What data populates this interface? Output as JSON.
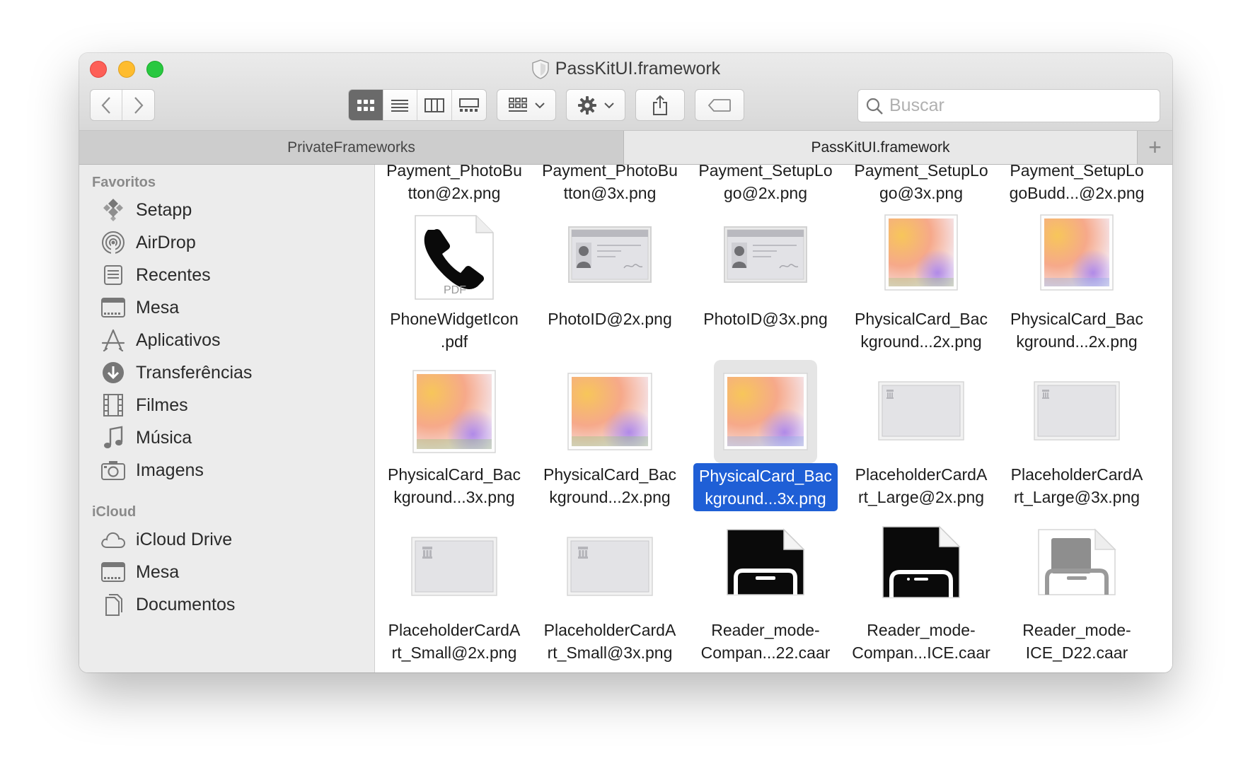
{
  "window": {
    "title": "PassKitUI.framework"
  },
  "toolbar": {
    "back": "‹",
    "forward": "›",
    "search_placeholder": "Buscar"
  },
  "tabs": [
    {
      "label": "PrivateFrameworks"
    },
    {
      "label": "PassKitUI.framework"
    },
    {
      "label": "+"
    }
  ],
  "sidebar": {
    "favorites_header": "Favoritos",
    "favorites": [
      {
        "label": "Setapp",
        "icon": "setapp-icon"
      },
      {
        "label": "AirDrop",
        "icon": "airdrop-icon"
      },
      {
        "label": "Recentes",
        "icon": "recents-icon"
      },
      {
        "label": "Mesa",
        "icon": "desktop-icon"
      },
      {
        "label": "Aplicativos",
        "icon": "applications-icon"
      },
      {
        "label": "Transferências",
        "icon": "downloads-icon"
      },
      {
        "label": "Filmes",
        "icon": "movies-icon"
      },
      {
        "label": "Música",
        "icon": "music-icon"
      },
      {
        "label": "Imagens",
        "icon": "pictures-icon"
      }
    ],
    "icloud_header": "iCloud",
    "icloud": [
      {
        "label": "iCloud Drive",
        "icon": "cloud-icon"
      },
      {
        "label": "Mesa",
        "icon": "desktop-icon"
      },
      {
        "label": "Documentos",
        "icon": "documents-icon"
      }
    ]
  },
  "files": {
    "row0": [
      {
        "l1": "Payment_PhotoBu",
        "l2": "tton@2x.png"
      },
      {
        "l1": "Payment_PhotoBu",
        "l2": "tton@3x.png"
      },
      {
        "l1": "Payment_SetupLo",
        "l2": "go@2x.png"
      },
      {
        "l1": "Payment_SetupLo",
        "l2": "go@3x.png"
      },
      {
        "l1": "Payment_SetupLo",
        "l2": "goBudd...@2x.png"
      }
    ],
    "row1": [
      {
        "l1": "PhoneWidgetIcon",
        "l2": ".pdf",
        "kind": "pdf-phone"
      },
      {
        "l1": "PhotoID@2x.png",
        "l2": "",
        "kind": "photoid"
      },
      {
        "l1": "PhotoID@3x.png",
        "l2": "",
        "kind": "photoid"
      },
      {
        "l1": "PhysicalCard_Bac",
        "l2": "kground...2x.png",
        "kind": "gradient"
      },
      {
        "l1": "PhysicalCard_Bac",
        "l2": "kground...2x.png",
        "kind": "gradient"
      }
    ],
    "row2": [
      {
        "l1": "PhysicalCard_Bac",
        "l2": "kground...3x.png",
        "kind": "gradient"
      },
      {
        "l1": "PhysicalCard_Bac",
        "l2": "kground...2x.png",
        "kind": "gradient"
      },
      {
        "l1": "PhysicalCard_Bac",
        "l2": "kground...3x.png",
        "kind": "gradient",
        "selected": true
      },
      {
        "l1": "PlaceholderCardA",
        "l2": "rt_Large@2x.png",
        "kind": "placeholder"
      },
      {
        "l1": "PlaceholderCardA",
        "l2": "rt_Large@3x.png",
        "kind": "placeholder"
      }
    ],
    "row3": [
      {
        "l1": "PlaceholderCardA",
        "l2": "rt_Small@2x.png",
        "kind": "placeholder"
      },
      {
        "l1": "PlaceholderCardA",
        "l2": "rt_Small@3x.png",
        "kind": "placeholder"
      },
      {
        "l1": "Reader_mode-",
        "l2": "Compan...22.caar",
        "kind": "reader-dark"
      },
      {
        "l1": "Reader_mode-",
        "l2": "Compan...ICE.caar",
        "kind": "reader-dark2"
      },
      {
        "l1": "Reader_mode-",
        "l2": "ICE_D22.caar",
        "kind": "reader-light"
      }
    ]
  },
  "colors": {
    "selection": "#1f5fd6",
    "sidebar_bg": "#ececec",
    "traffic_red": "#fd5f57",
    "traffic_yellow": "#febc2e",
    "traffic_green": "#28c840"
  }
}
